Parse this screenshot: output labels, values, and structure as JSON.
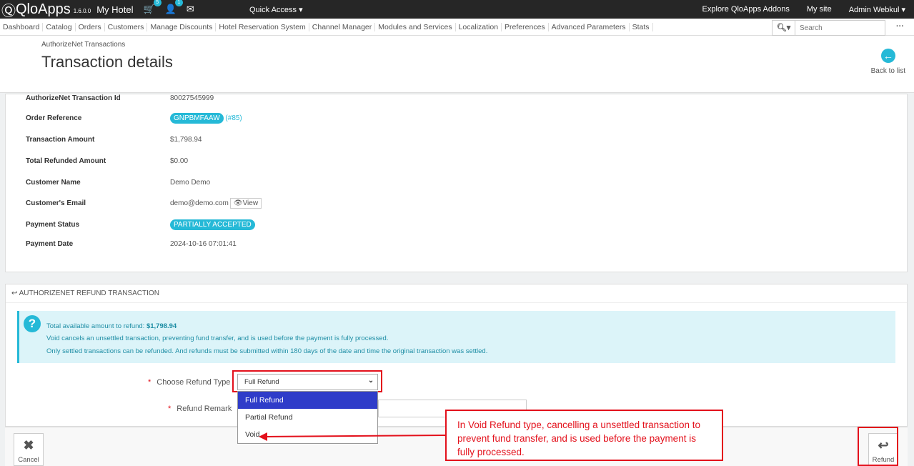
{
  "topbar": {
    "brand": "QloApps",
    "version": "1.6.0.0",
    "shop": "My Hotel",
    "cart_badge": "5",
    "user_badge": "1",
    "quick_access": "Quick Access ▾",
    "addons": "Explore QloApps Addons",
    "my_site": "My site",
    "admin": "Admin Webkul ▾"
  },
  "nav": {
    "items": [
      "Dashboard",
      "Catalog",
      "Orders",
      "Customers",
      "Manage Discounts",
      "Hotel Reservation System",
      "Channel Manager",
      "Modules and Services",
      "Localization",
      "Preferences",
      "Advanced Parameters",
      "Stats"
    ],
    "search_placeholder": "Search"
  },
  "header": {
    "breadcrumb": "AuthorizeNet Transactions",
    "title": "Transaction details",
    "back": "Back to list"
  },
  "details": [
    {
      "label": "AuthorizeNet Transaction Id",
      "value": "80027545999"
    },
    {
      "label": "Order Reference",
      "value": "GNPBMFAAW",
      "extra": "(#85)"
    },
    {
      "label": "Transaction Amount",
      "value": "$1,798.94"
    },
    {
      "label": "Total Refunded Amount",
      "value": "$0.00"
    },
    {
      "label": "Customer Name",
      "value": "Demo Demo"
    },
    {
      "label": "Customer's Email",
      "value": "demo@demo.com",
      "extra": "View"
    },
    {
      "label": "Payment Status",
      "value": "PARTIALLY ACCEPTED"
    },
    {
      "label": "Payment Date",
      "value": "2024-10-16 07:01:41"
    }
  ],
  "refund": {
    "section_title": "AUTHORIZENET REFUND TRANSACTION",
    "alert": {
      "line1_prefix": "Total available amount to refund: ",
      "line1_amount": "$1,798.94",
      "line2": "Void cancels an unsettled transaction, preventing fund transfer, and is used before the payment is fully processed.",
      "line3": "Only settled transactions can be refunded. And refunds must be submitted within 180 days of the date and time the original transaction was settled."
    },
    "type_label": "Choose Refund Type",
    "type_value": "Full Refund",
    "options": [
      "Full Refund",
      "Partial Refund",
      "Void"
    ],
    "remark_label": "Refund Remark",
    "cancel": "Cancel",
    "submit": "Refund"
  },
  "annotation": "In Void Refund type, cancelling a unsettled transaction to prevent fund transfer, and is used before the payment is fully processed.",
  "colors": {
    "accent": "#25b9d7",
    "annotation": "#e3101b",
    "selected_option": "#2f3cc9"
  }
}
